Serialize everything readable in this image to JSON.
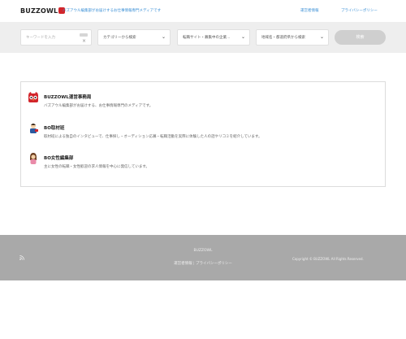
{
  "header": {
    "logo_text": "BUZZOWL",
    "tagline": "バズアウル編集部がお届けするお仕事情報専門メディアです",
    "links": [
      "運営者情報",
      "プライバシーポリシー"
    ]
  },
  "search": {
    "keyword_placeholder": "キーワードを入力",
    "selects": [
      "カテゴリーから検索",
      "転職サイト・募集中の企業…",
      "地域名・都道府県から検索"
    ],
    "button_label": "検索"
  },
  "authors": [
    {
      "title": "BUZZOWL運営事務局",
      "desc": "バズアウル編集部がお届けする、お仕事情報専門のメディアです。",
      "icon": "owl-icon"
    },
    {
      "title": "BO取材班",
      "desc": "取材班による独自のインタビューで、仕事探し・オーディション応募・転職活動を実際に体験した人の話やリコミを紹介しています。",
      "icon": "reporter-icon"
    },
    {
      "title": "BO女性編集部",
      "desc": "主に女性の転職・女性歓迎の求人情報を中心に発信しています。",
      "icon": "woman-icon"
    }
  ],
  "footer": {
    "brand": "BUZZOWL",
    "links": [
      "運営者情報",
      "プライバシーポリシー"
    ],
    "copyright": "Copyright © BUZZOWL All Rights Reserved."
  },
  "colors": {
    "accent_link": "#3a8fd6",
    "brand_red": "#d2252b",
    "footer_bg": "#a9a9a9",
    "search_band_bg": "#eeeeee"
  }
}
